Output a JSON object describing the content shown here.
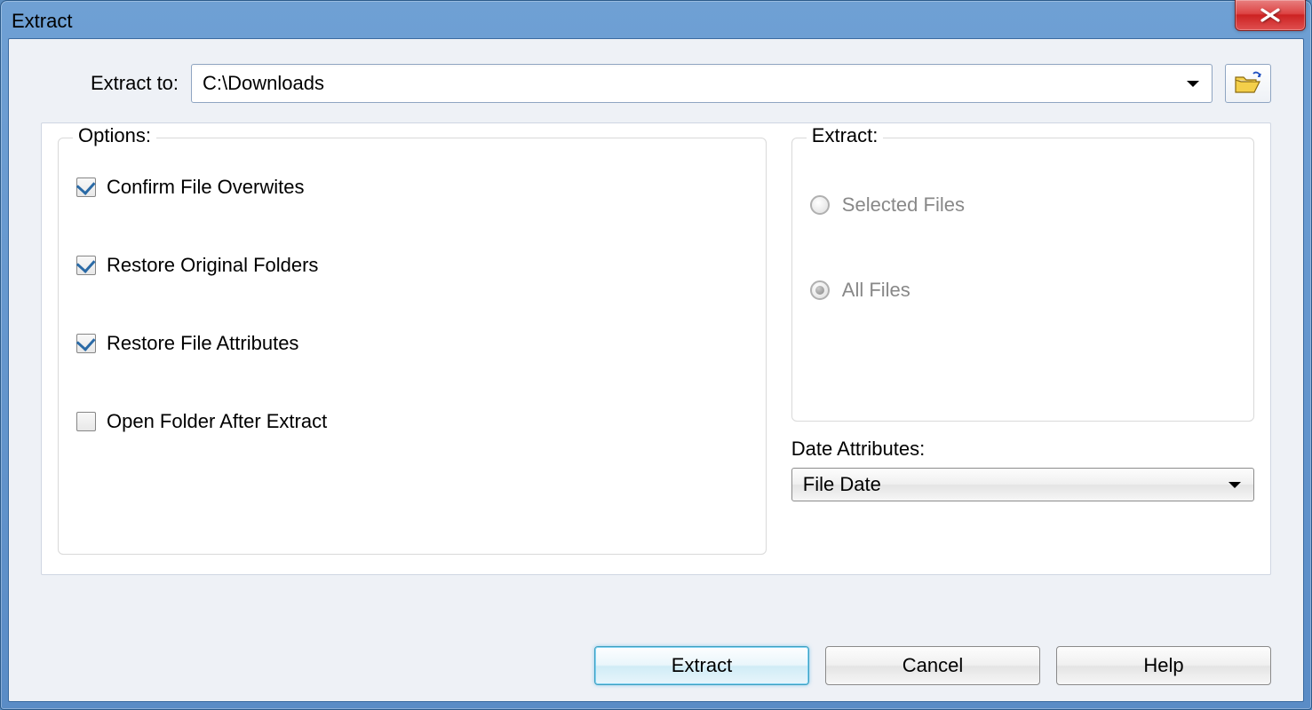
{
  "window": {
    "title": "Extract"
  },
  "path": {
    "label": "Extract to:",
    "value": "C:\\Downloads"
  },
  "options": {
    "legend": "Options:",
    "items": [
      {
        "label": "Confirm File Overwites",
        "checked": true
      },
      {
        "label": "Restore Original Folders",
        "checked": true
      },
      {
        "label": "Restore File Attributes",
        "checked": true
      },
      {
        "label": "Open Folder After Extract",
        "checked": false
      }
    ]
  },
  "extract_scope": {
    "legend": "Extract:",
    "items": [
      {
        "label": "Selected Files",
        "selected": false
      },
      {
        "label": "All Files",
        "selected": true
      }
    ]
  },
  "date_attributes": {
    "label": "Date Attributes:",
    "value": "File Date"
  },
  "buttons": {
    "extract": "Extract",
    "cancel": "Cancel",
    "help": "Help"
  }
}
